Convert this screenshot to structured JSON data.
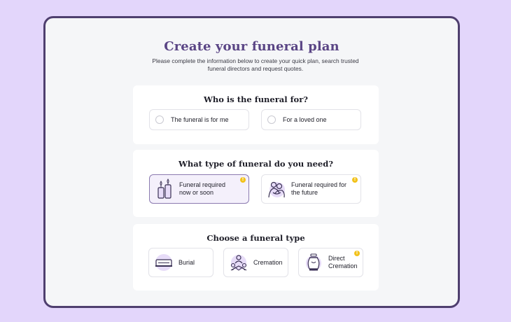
{
  "page": {
    "title": "Create your funeral plan",
    "subtitle": "Please complete the information below to create your quick plan, search trusted funeral directors and request quotes."
  },
  "section_who": {
    "question": "Who is the funeral for?",
    "options": [
      {
        "label": "The funeral is for me",
        "selected": false
      },
      {
        "label": "For a loved one",
        "selected": false
      }
    ]
  },
  "section_when": {
    "question": "What type of funeral do you need?",
    "options": [
      {
        "label": "Funeral required now or soon",
        "icon": "candles-icon",
        "selected": true,
        "info": true
      },
      {
        "label": "Funeral required for the future",
        "icon": "hug-icon",
        "selected": false,
        "info": true
      }
    ]
  },
  "section_type": {
    "question": "Choose a funeral type",
    "options": [
      {
        "label": "Burial",
        "icon": "coffin-icon",
        "selected": false,
        "info": false
      },
      {
        "label": "Cremation",
        "icon": "cremation-icon",
        "selected": false,
        "info": false
      },
      {
        "label": "Direct Cremation",
        "icon": "urn-icon",
        "selected": false,
        "info": true
      }
    ]
  },
  "colors": {
    "background": "#e3d6fb",
    "frame_border": "#4f3f6f",
    "title": "#5a4585",
    "selected_border": "#8b7ab0",
    "info_badge": "#f2c21b"
  },
  "info_glyph": "!"
}
